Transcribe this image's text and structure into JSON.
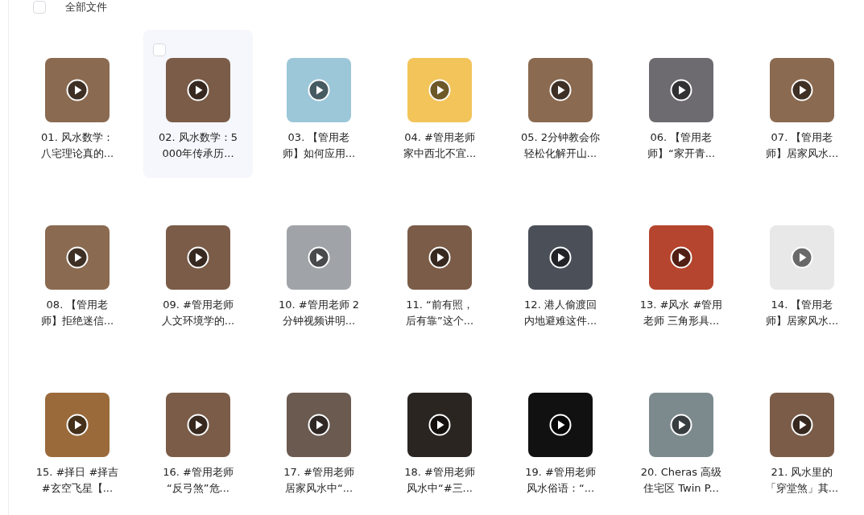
{
  "header": {
    "label": "全部文件",
    "checked": false
  },
  "files": [
    {
      "lines": [
        "01. 风水数学：",
        "八宅理论真的..."
      ],
      "hovered": false,
      "color": "#8a6a50"
    },
    {
      "lines": [
        "02. 风水数学：5",
        "000年传承历..."
      ],
      "hovered": true,
      "color": "#7a5c48"
    },
    {
      "lines": [
        "03. 【管用老",
        "师】如何应用..."
      ],
      "hovered": false,
      "color": "#9cc7d9"
    },
    {
      "lines": [
        "04. #管用老师",
        "家中西北不宜..."
      ],
      "hovered": false,
      "color": "#f2c45a"
    },
    {
      "lines": [
        "05. 2分钟教会你",
        "轻松化解开山..."
      ],
      "hovered": false,
      "color": "#8a6a50"
    },
    {
      "lines": [
        "06. 【管用老",
        "师】“家开青..."
      ],
      "hovered": false,
      "color": "#6d6a70"
    },
    {
      "lines": [
        "07. 【管用老",
        "师】居家风水..."
      ],
      "hovered": false,
      "color": "#8a6a50"
    },
    {
      "lines": [
        "08. 【管用老",
        "师】拒绝迷信..."
      ],
      "hovered": false,
      "color": "#8a6a50"
    },
    {
      "lines": [
        "09. #管用老师",
        "人文环境学的..."
      ],
      "hovered": false,
      "color": "#7a5c48"
    },
    {
      "lines": [
        "10. #管用老师 2",
        "分钟视频讲明..."
      ],
      "hovered": false,
      "color": "#a0a4a8"
    },
    {
      "lines": [
        "11. “前有照，",
        "后有靠”这个..."
      ],
      "hovered": false,
      "color": "#7a5c48"
    },
    {
      "lines": [
        "12. 港人偷渡回",
        "内地避难这件..."
      ],
      "hovered": false,
      "color": "#4a4f58"
    },
    {
      "lines": [
        "13. #风水 #管用",
        "老师 三角形具..."
      ],
      "hovered": false,
      "color": "#b5452e"
    },
    {
      "lines": [
        "14. 【管用老",
        "师】居家风水..."
      ],
      "hovered": false,
      "color": "#e8e8e8"
    },
    {
      "lines": [
        "15. #择日 #择吉",
        "#玄空飞星【..."
      ],
      "hovered": false,
      "color": "#9a6a3a"
    },
    {
      "lines": [
        "16. #管用老师",
        "“反弓煞”危..."
      ],
      "hovered": false,
      "color": "#7a5c48"
    },
    {
      "lines": [
        "17. #管用老师",
        "居家风水中“..."
      ],
      "hovered": false,
      "color": "#6a5a50"
    },
    {
      "lines": [
        "18. #管用老师",
        "风水中“#三..."
      ],
      "hovered": false,
      "color": "#2a2520"
    },
    {
      "lines": [
        "19. #管用老师",
        "风水俗语：“..."
      ],
      "hovered": false,
      "color": "#111111"
    },
    {
      "lines": [
        "20. Cheras 高级",
        "住宅区 Twin P..."
      ],
      "hovered": false,
      "color": "#7c8a8e"
    },
    {
      "lines": [
        "21. 风水里的",
        "「穿堂煞」其..."
      ],
      "hovered": false,
      "color": "#7a5c48"
    }
  ]
}
